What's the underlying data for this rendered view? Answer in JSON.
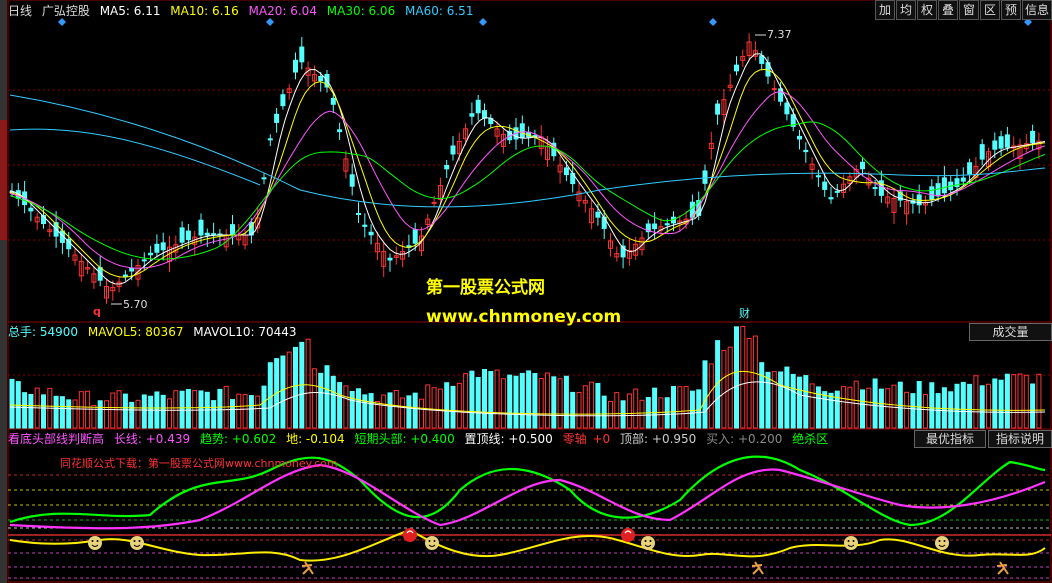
{
  "header": {
    "period": "日线",
    "stock": "广弘控股",
    "ma": [
      {
        "label": "MA5: 6.11",
        "color": "#ffffff"
      },
      {
        "label": "MA10: 6.16",
        "color": "#ffff00"
      },
      {
        "label": "MA20: 6.04",
        "color": "#ff55ff"
      },
      {
        "label": "MA30: 6.06",
        "color": "#00ff00"
      },
      {
        "label": "MA60: 6.51",
        "color": "#33ccff"
      }
    ]
  },
  "toolbar": [
    "加",
    "均",
    "权",
    "叠",
    "窗",
    "区",
    "预",
    "信息"
  ],
  "price_panel": {
    "high_label": "7.37",
    "low_label": "5.70",
    "low_marker": "q",
    "finance_marker": "财",
    "watermark1": "第一股票公式网",
    "watermark2": "www.chnmoney.com"
  },
  "volume_panel": {
    "total": "总手: 54900",
    "mavol5": "MAVOL5: 80367",
    "mavol10": "MAVOL10: 70443",
    "button": "成交量"
  },
  "indicator_panel": {
    "title": "看底头部线判断高",
    "items": [
      {
        "text": "长线: +0.439",
        "color": "#ff55ff"
      },
      {
        "text": "趋势: +0.602",
        "color": "#00ff00"
      },
      {
        "text": "地: -0.104",
        "color": "#ffff00"
      },
      {
        "text": "短期头部: +0.400",
        "color": "#00ff00"
      },
      {
        "text": "置顶线: +0.500",
        "color": "#ffffff"
      },
      {
        "text": "零轴",
        "color": "#ff3333"
      },
      {
        "text": "+0",
        "color": "#ff3333"
      },
      {
        "text": "顶部: +0.950",
        "color": "#cccccc"
      },
      {
        "text": "买入: +0.200",
        "color": "#888888"
      },
      {
        "text": "绝杀区",
        "color": "#00ff00"
      }
    ],
    "note": "同花顺公式下载：第一股票公式网www.chnmoney.com",
    "btn_optimal": "最优指标",
    "btn_help": "指标说明"
  },
  "colors": {
    "up": "#ff3333",
    "down": "#54ffff",
    "grid": "#8b0000"
  }
}
